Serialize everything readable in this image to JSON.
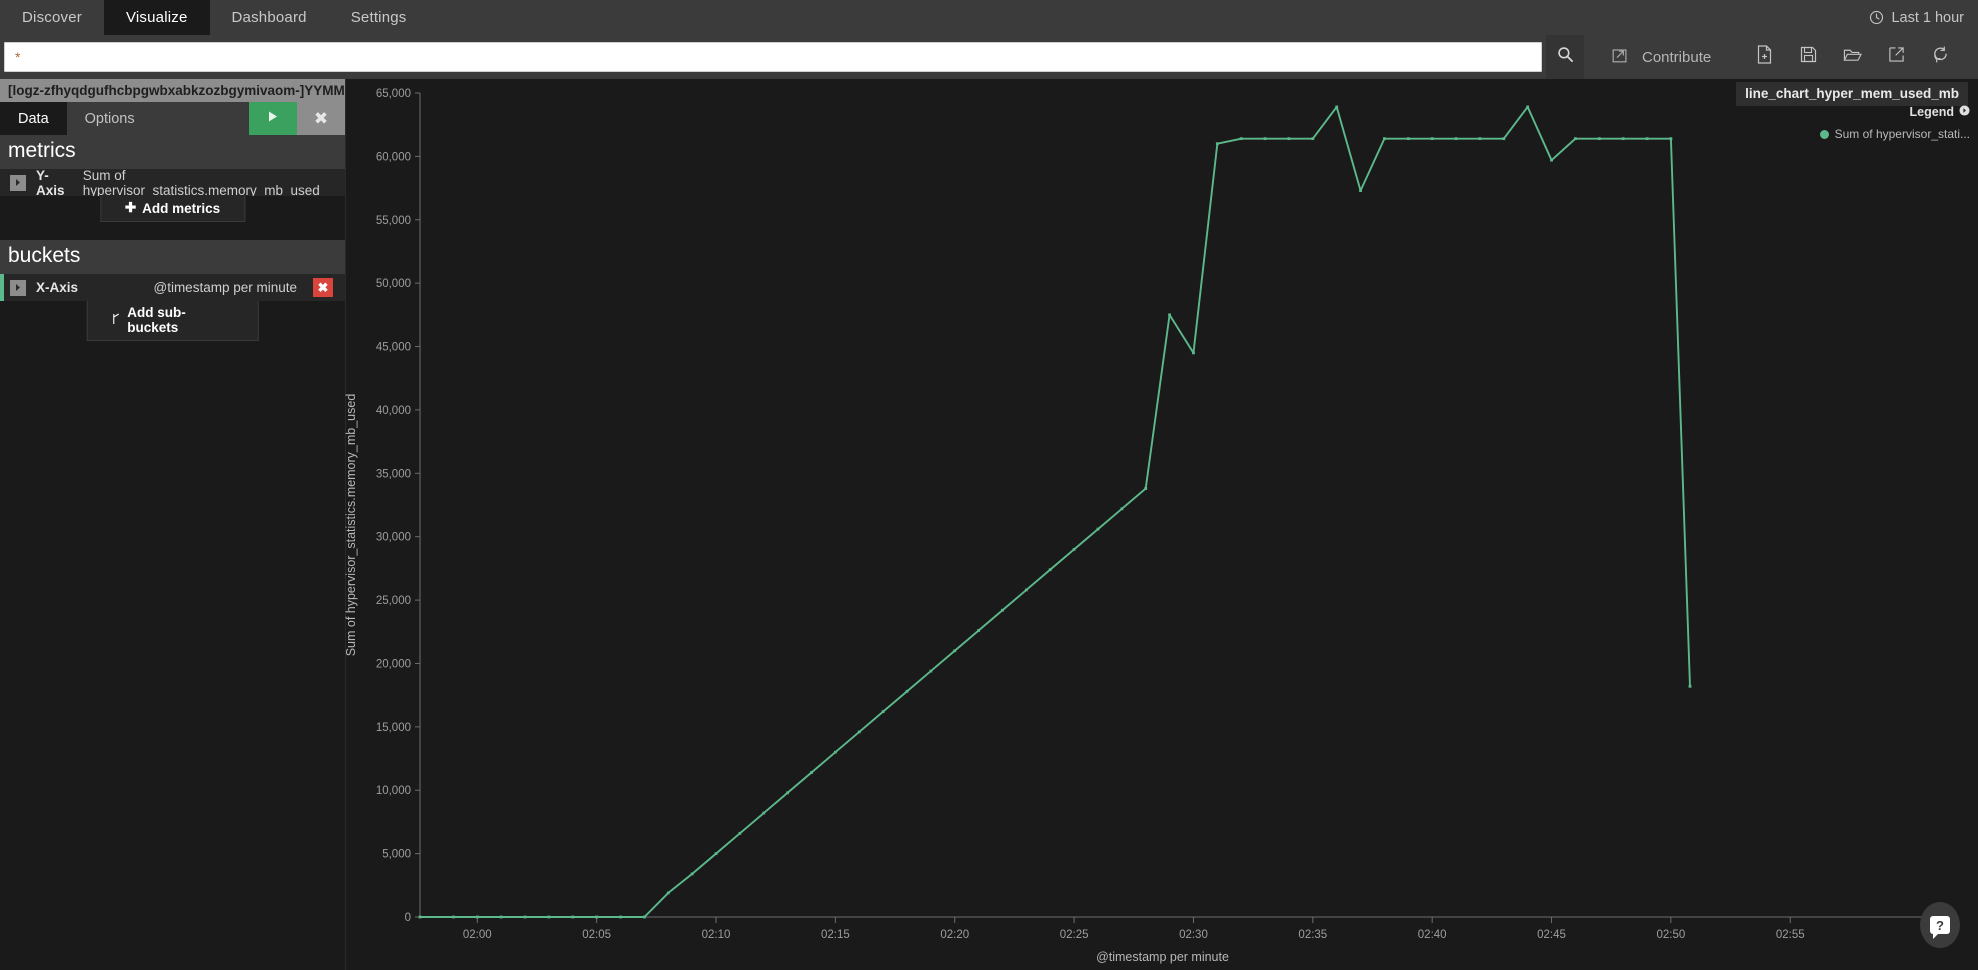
{
  "nav": {
    "items": [
      {
        "label": "Discover",
        "active": false
      },
      {
        "label": "Visualize",
        "active": true
      },
      {
        "label": "Dashboard",
        "active": false
      },
      {
        "label": "Settings",
        "active": false
      }
    ],
    "time_picker": "Last 1 hour",
    "clock_icon": "clock-icon"
  },
  "query": {
    "value": "*",
    "placeholder": "",
    "search_icon": "search-icon",
    "contribute_label": "Contribute",
    "contribute_icon": "external-link-square-icon",
    "actions": [
      {
        "name": "new-visualization-button",
        "icon": "new-document-icon"
      },
      {
        "name": "save-visualization-button",
        "icon": "floppy-disk-icon"
      },
      {
        "name": "load-visualization-button",
        "icon": "folder-open-icon"
      },
      {
        "name": "share-visualization-button",
        "icon": "share-external-icon"
      },
      {
        "name": "refresh-visualization-button",
        "icon": "refresh-icon"
      }
    ]
  },
  "sidebar": {
    "index_pattern": "[logz-zfhyqdgufhcbpgwbxabkzozbgymivaom-]YYMMDD",
    "tabs": [
      {
        "label": "Data",
        "active": true
      },
      {
        "label": "Options",
        "active": false
      }
    ],
    "apply_icon": "play-icon",
    "discard_icon": "close-icon",
    "metrics": {
      "heading": "metrics",
      "rows": [
        {
          "label": "Y-Axis",
          "value": "Sum of hypervisor_statistics.memory_mb_used"
        }
      ],
      "add_label": "Add metrics",
      "add_icon": "plus-icon"
    },
    "buckets": {
      "heading": "buckets",
      "rows": [
        {
          "label": "X-Axis",
          "value": "@timestamp per minute",
          "remove": "✖"
        }
      ],
      "add_label": "Add sub-buckets",
      "add_icon": "branch-icon"
    }
  },
  "visualization": {
    "title": "line_chart_hyper_mem_used_mb",
    "legend": {
      "title": "Legend",
      "toggle_icon": "chevron-right-circle-icon",
      "entries": [
        {
          "label": "Sum of hypervisor_stati...",
          "color": "#5cb98b"
        }
      ]
    },
    "help_icon": "help-question-icon"
  },
  "chart_data": {
    "type": "line",
    "title": "line_chart_hyper_mem_used_mb",
    "xlabel": "@timestamp per minute",
    "ylabel": "Sum of hypervisor_statistics.memory_mb_used",
    "series_name": "Sum of hypervisor_statistics.memory_mb_used",
    "color": "#5cb98b",
    "grid": false,
    "legend_position": "right",
    "ylim": [
      0,
      65000
    ],
    "yticks": [
      0,
      5000,
      10000,
      15000,
      20000,
      25000,
      30000,
      35000,
      40000,
      45000,
      50000,
      55000,
      60000,
      65000
    ],
    "ytick_labels": [
      "0",
      "5,000",
      "10,000",
      "15,000",
      "20,000",
      "25,000",
      "30,000",
      "35,000",
      "40,000",
      "45,000",
      "50,000",
      "55,000",
      "60,000",
      "65,000"
    ],
    "xticks": [
      "02:00",
      "02:05",
      "02:10",
      "02:15",
      "02:20",
      "02:25",
      "02:30",
      "02:35",
      "02:40",
      "02:45",
      "02:50",
      "02:55"
    ],
    "xlim_minutes": [
      117.6,
      177.0
    ],
    "points": [
      {
        "t": 117.6,
        "v": 0
      },
      {
        "t": 119.0,
        "v": 0
      },
      {
        "t": 120.0,
        "v": 0
      },
      {
        "t": 121.0,
        "v": 0
      },
      {
        "t": 122.0,
        "v": 0
      },
      {
        "t": 123.0,
        "v": 0
      },
      {
        "t": 124.0,
        "v": 0
      },
      {
        "t": 125.0,
        "v": 0
      },
      {
        "t": 126.0,
        "v": 0
      },
      {
        "t": 127.0,
        "v": 0
      },
      {
        "t": 128.0,
        "v": 1900
      },
      {
        "t": 129.0,
        "v": 3400
      },
      {
        "t": 130.0,
        "v": 5000
      },
      {
        "t": 131.0,
        "v": 6600
      },
      {
        "t": 132.0,
        "v": 8200
      },
      {
        "t": 133.0,
        "v": 9800
      },
      {
        "t": 134.0,
        "v": 11400
      },
      {
        "t": 135.0,
        "v": 13000
      },
      {
        "t": 136.0,
        "v": 14600
      },
      {
        "t": 137.0,
        "v": 16200
      },
      {
        "t": 138.0,
        "v": 17800
      },
      {
        "t": 139.0,
        "v": 19400
      },
      {
        "t": 140.0,
        "v": 21000
      },
      {
        "t": 141.0,
        "v": 22600
      },
      {
        "t": 142.0,
        "v": 24200
      },
      {
        "t": 143.0,
        "v": 25800
      },
      {
        "t": 144.0,
        "v": 27400
      },
      {
        "t": 145.0,
        "v": 29000
      },
      {
        "t": 146.0,
        "v": 30600
      },
      {
        "t": 147.0,
        "v": 32200
      },
      {
        "t": 148.0,
        "v": 33800
      },
      {
        "t": 149.0,
        "v": 47500
      },
      {
        "t": 150.0,
        "v": 44500
      },
      {
        "t": 151.0,
        "v": 61000
      },
      {
        "t": 152.0,
        "v": 61400
      },
      {
        "t": 153.0,
        "v": 61400
      },
      {
        "t": 154.0,
        "v": 61400
      },
      {
        "t": 155.0,
        "v": 61400
      },
      {
        "t": 156.0,
        "v": 63900
      },
      {
        "t": 157.0,
        "v": 57300
      },
      {
        "t": 158.0,
        "v": 61400
      },
      {
        "t": 159.0,
        "v": 61400
      },
      {
        "t": 160.0,
        "v": 61400
      },
      {
        "t": 161.0,
        "v": 61400
      },
      {
        "t": 162.0,
        "v": 61400
      },
      {
        "t": 163.0,
        "v": 61400
      },
      {
        "t": 164.0,
        "v": 63900
      },
      {
        "t": 165.0,
        "v": 59700
      },
      {
        "t": 166.0,
        "v": 61400
      },
      {
        "t": 167.0,
        "v": 61400
      },
      {
        "t": 168.0,
        "v": 61400
      },
      {
        "t": 169.0,
        "v": 61400
      },
      {
        "t": 170.0,
        "v": 61400
      },
      {
        "t": 170.8,
        "v": 18200
      }
    ]
  }
}
